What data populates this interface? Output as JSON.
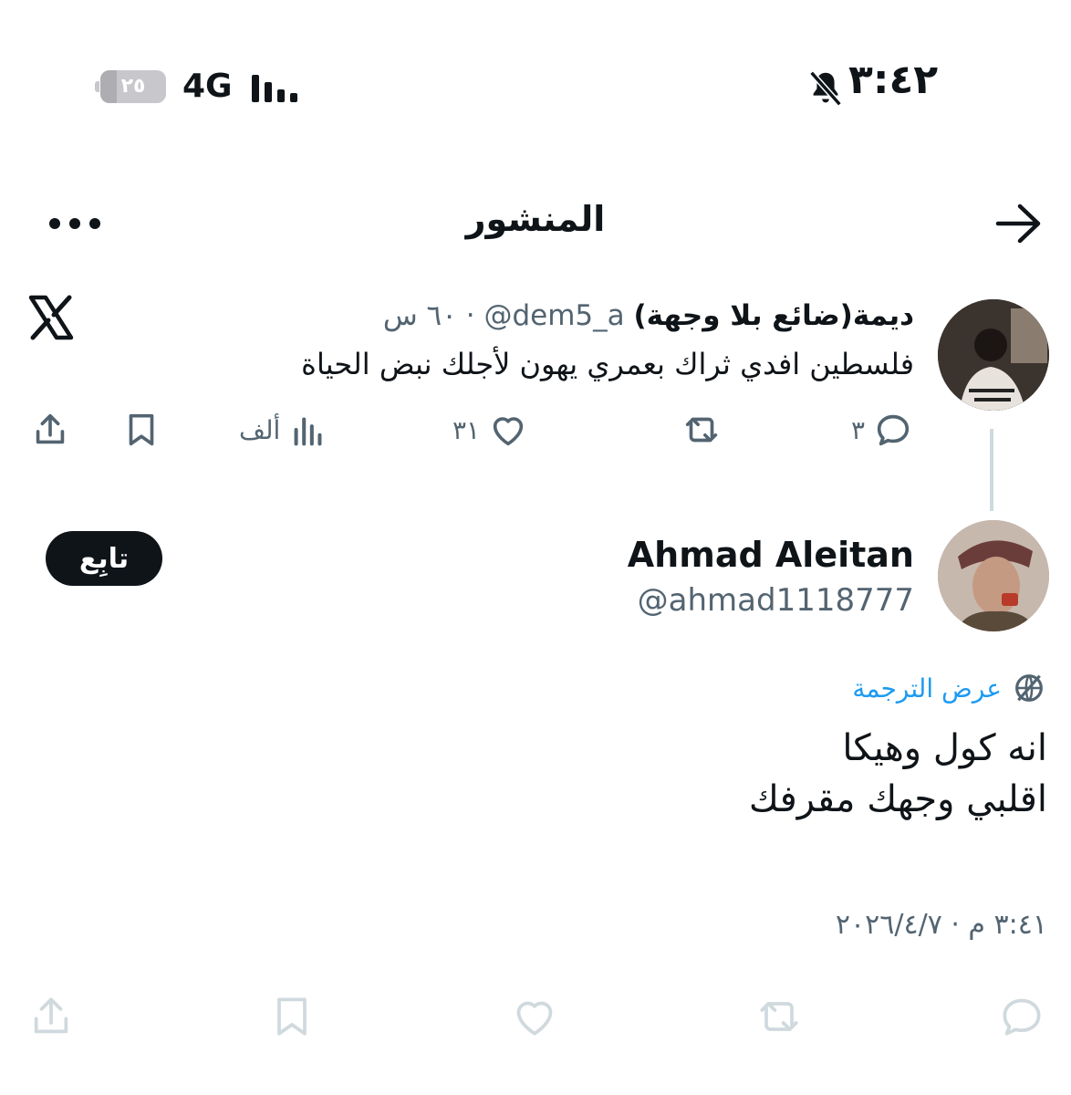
{
  "status_bar": {
    "time": "٣:٤٢",
    "network": "4G",
    "battery": "٢٥",
    "battery_level": 0.25,
    "icons": [
      "bell-slash-icon",
      "signal-bars-icon",
      "battery-icon"
    ]
  },
  "header": {
    "title": "المنشور",
    "icons": [
      "back-arrow-icon",
      "more-icon"
    ]
  },
  "quoted_post": {
    "display_name": "ديمة(ضائع بلا وجهة)",
    "handle": "@dem5_a",
    "separator": "·",
    "time_ago": "٦٠ س",
    "text": "فلسطين افدي ثراك بعمري يهون لأجلك نبض الحياة",
    "replies": "٣",
    "likes": "٣١",
    "views": "ألف",
    "source_icon": "x-logo-icon"
  },
  "main_post": {
    "author_name": "Ahmad Aleitan",
    "author_handle": "@ahmad1118777",
    "follow_label": "تابِع",
    "translate_label": "عرض الترجمة",
    "body": "انه كول وهيكا\nاقلبي وجهك مقرفك",
    "timestamp": "٣:٤١ م · ٢٠٢٦/٤/٧"
  },
  "colors": {
    "text": "#0f1419",
    "muted": "#536471",
    "link": "#1d9bf0",
    "action_icons_faded": "#cfd9de"
  }
}
